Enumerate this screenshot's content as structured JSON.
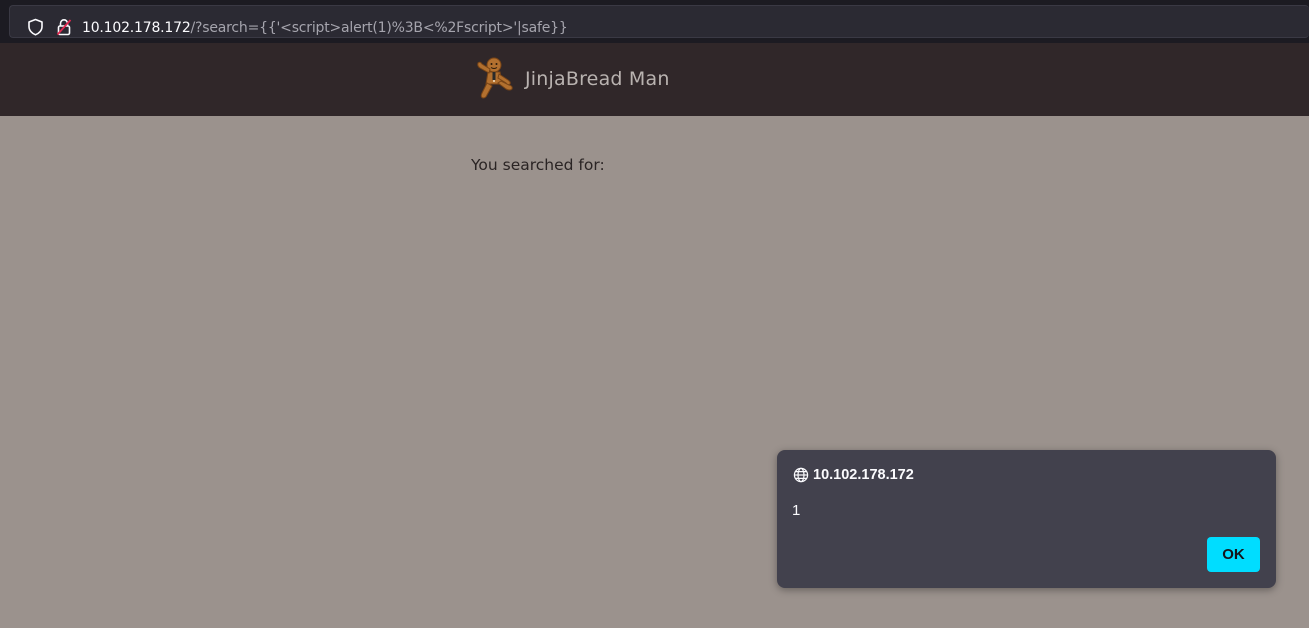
{
  "browser": {
    "url_host": "10.102.178.172",
    "url_path": "/?search={{'<script>alert(1)%3B<%2Fscript>'|safe}}",
    "icons": [
      "shield-icon",
      "insecure-lock-icon"
    ]
  },
  "site": {
    "brand_name": "JinjaBread Man",
    "logo_icon": "gingerbread-man-logo",
    "header_color": "#302729",
    "background_color": "#9b928d"
  },
  "main": {
    "search_label": "You searched for:"
  },
  "alert_dialog": {
    "origin": "10.102.178.172",
    "origin_icon": "globe-icon",
    "message": "1",
    "ok_label": "OK",
    "accent_color": "#00ddff"
  }
}
